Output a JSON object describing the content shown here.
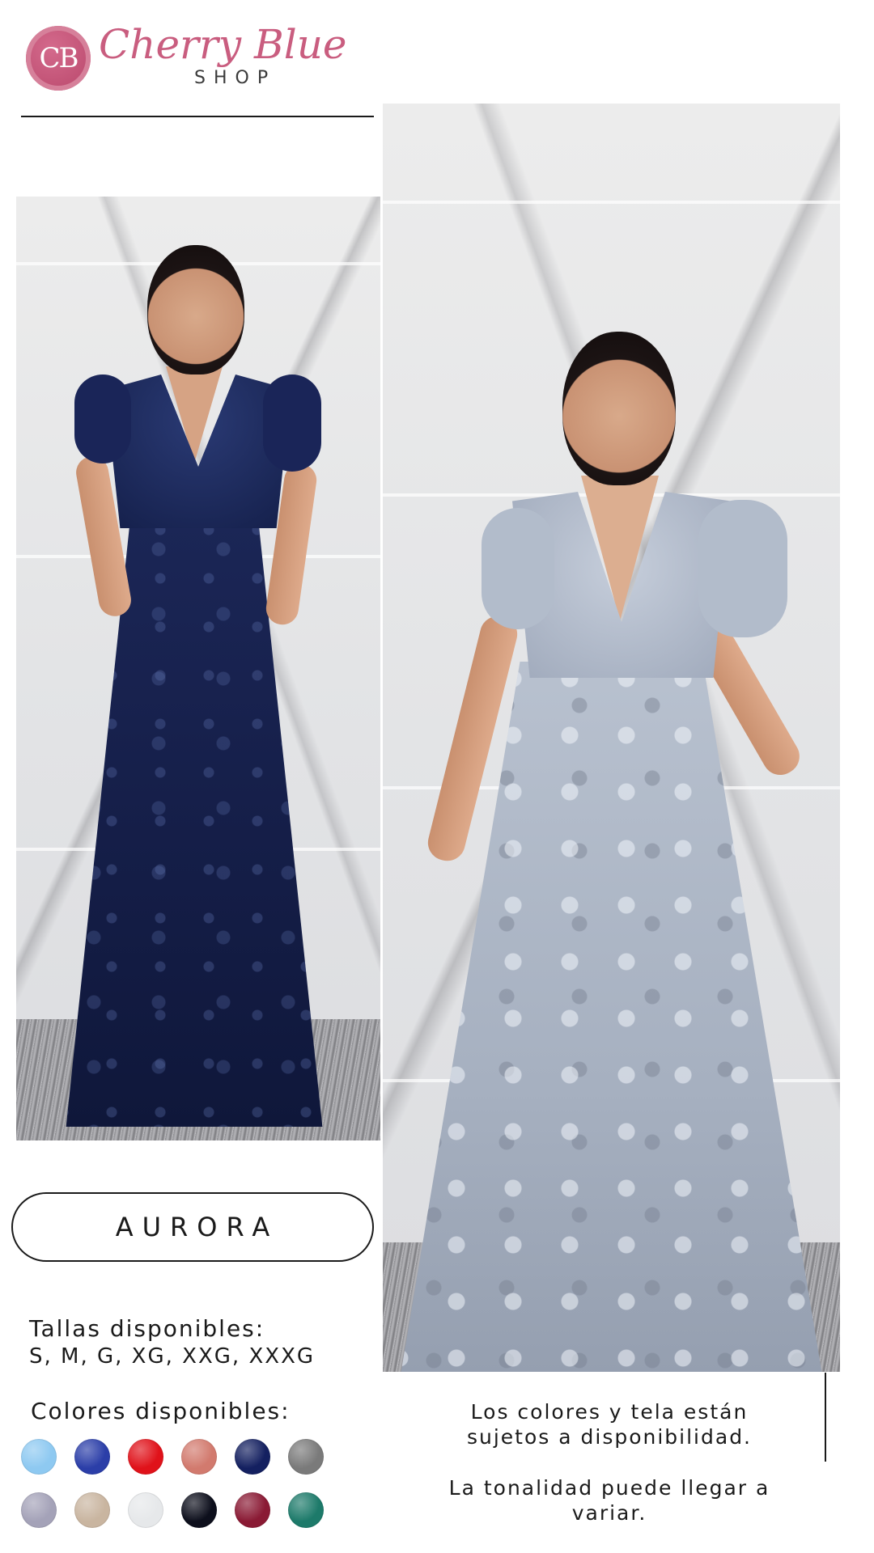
{
  "brand": {
    "badge_text": "CB",
    "name": "Cherry Blue",
    "sub": "SHOP",
    "primary_color": "#c95d7f"
  },
  "product": {
    "name": "AURORA",
    "sizes_title": "Tallas disponibles:",
    "sizes": "S, M, G, XG, XXG, XXXG",
    "colors_title": "Colores disponibles:",
    "swatches": [
      {
        "name": "light-blue",
        "color": "#8ec9f1"
      },
      {
        "name": "royal-blue-sequin",
        "color": "#2b3ea8"
      },
      {
        "name": "red",
        "color": "#e0121a"
      },
      {
        "name": "coral-stripe",
        "color": "#d27a6e"
      },
      {
        "name": "navy",
        "color": "#142060"
      },
      {
        "name": "gray",
        "color": "#7a7a7a"
      },
      {
        "name": "lavender-marble",
        "color": "#a4a2b8"
      },
      {
        "name": "champagne-marble",
        "color": "#c9b5a0"
      },
      {
        "name": "white-marble",
        "color": "#e6e8ea"
      },
      {
        "name": "black",
        "color": "#0d0f1c"
      },
      {
        "name": "burgundy",
        "color": "#8a1a34"
      },
      {
        "name": "emerald",
        "color": "#1d7a6a"
      }
    ]
  },
  "notes": {
    "line1": "Los colores y tela están sujetos a disponibilidad.",
    "line2": "La tonalidad puede llegar a variar."
  },
  "photos": [
    {
      "name": "navy-dress-photo",
      "dress_color": "#141d46"
    },
    {
      "name": "silver-blue-dress-photo",
      "dress_color": "#a6b0c0"
    }
  ]
}
